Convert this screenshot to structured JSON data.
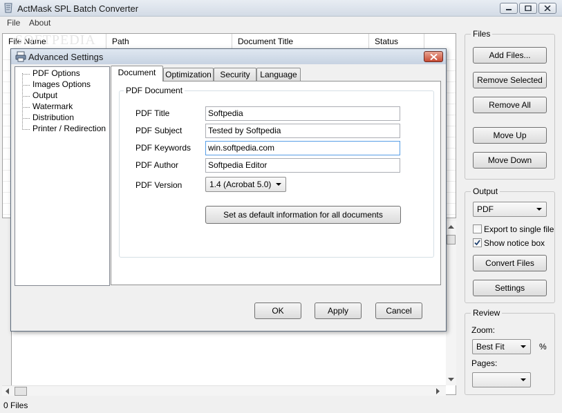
{
  "window": {
    "title": "ActMask SPL Batch Converter",
    "watermark": "SOFTPEDIA"
  },
  "menu": [
    "File",
    "About"
  ],
  "file_list": {
    "columns": [
      "File Name",
      "Path",
      "Document Title",
      "Status"
    ]
  },
  "files_group": {
    "label": "Files",
    "buttons": [
      "Add Files...",
      "Remove Selected",
      "Remove All",
      "Move Up",
      "Move Down"
    ]
  },
  "output_group": {
    "label": "Output",
    "format": "PDF",
    "export_single_label": "Export to single file",
    "export_single_checked": false,
    "show_notice_label": "Show notice box",
    "show_notice_checked": true,
    "convert_label": "Convert Files",
    "settings_label": "Settings"
  },
  "review_group": {
    "label": "Review",
    "zoom_label": "Zoom:",
    "zoom_value": "Best Fit",
    "zoom_unit": "%",
    "pages_label": "Pages:",
    "pages_value": ""
  },
  "status": "0 Files",
  "dialog": {
    "title": "Advanced Settings",
    "tree": [
      "PDF Options",
      "Images Options",
      "Output",
      "Watermark",
      "Distribution",
      "Printer / Redirection"
    ],
    "tabs": [
      "Document",
      "Optimization",
      "Security",
      "Language"
    ],
    "active_tab": "Document",
    "group_label": "PDF Document",
    "fields": {
      "title_label": "PDF Title",
      "title_value": "Softpedia",
      "subject_label": "PDF Subject",
      "subject_value": "Tested by Softpedia",
      "keywords_label": "PDF Keywords",
      "keywords_value": "win.softpedia.com",
      "author_label": "PDF Author",
      "author_value": "Softpedia Editor",
      "version_label": "PDF Version",
      "version_value": "1.4  (Acrobat 5.0)"
    },
    "default_button": "Set as default information for all documents",
    "ok": "OK",
    "apply": "Apply",
    "cancel": "Cancel"
  }
}
